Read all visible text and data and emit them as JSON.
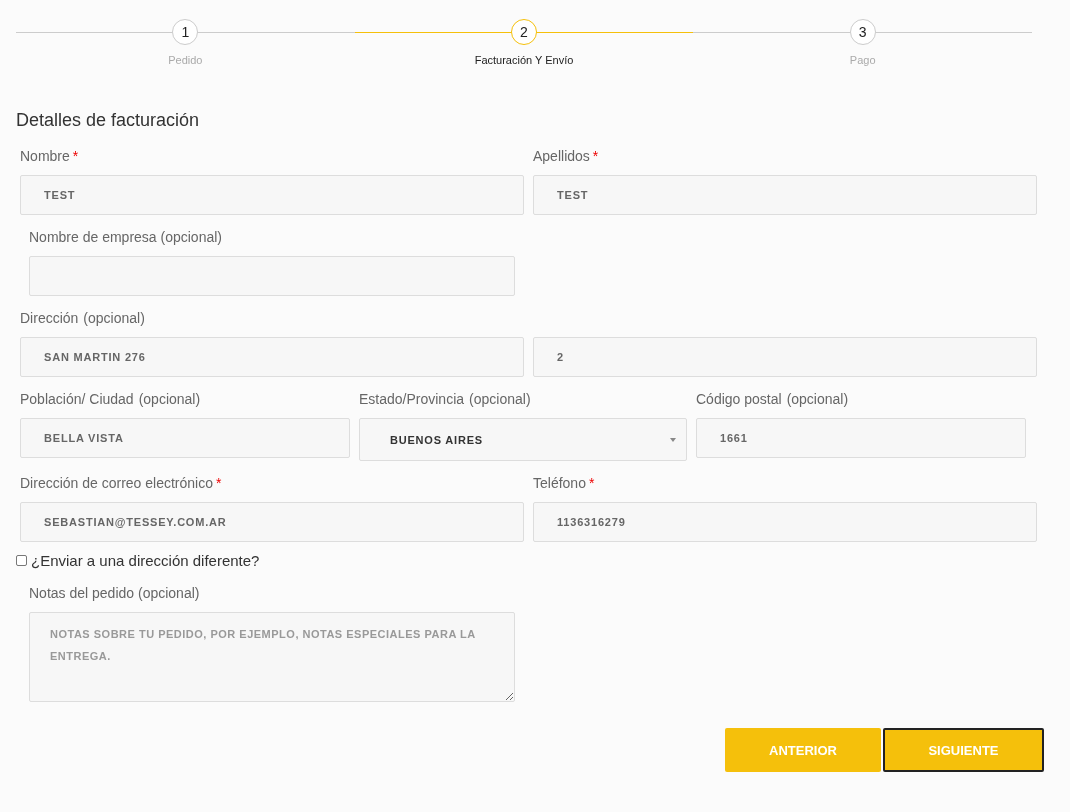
{
  "steps": [
    {
      "number": "1",
      "label": "Pedido",
      "selected": false
    },
    {
      "number": "2",
      "label": "Facturación Y Envío",
      "selected": true
    },
    {
      "number": "3",
      "label": "Pago",
      "selected": false
    }
  ],
  "heading": "Detalles de facturación",
  "rows": [
    {
      "kind": "half",
      "fields": [
        {
          "kind": "text",
          "label": "Nombre",
          "required_mark": "*",
          "value": "TEST"
        },
        {
          "kind": "text",
          "label": "Apellidos",
          "required_mark": "*",
          "value": "TEST"
        }
      ]
    },
    {
      "kind": "indented",
      "fields": [
        {
          "kind": "text",
          "label": "Nombre de empresa (opcional)"
        }
      ]
    },
    {
      "kind": "half",
      "fields": [
        {
          "kind": "text",
          "label": "Dirección",
          "optional_note": "(opcional)",
          "value": "SAN MARTIN 276"
        },
        {
          "kind": "text",
          "value": "2"
        }
      ]
    },
    {
      "kind": "third",
      "fields": [
        {
          "kind": "text",
          "label": "Población/ Ciudad",
          "optional_note": "(opcional)",
          "value": "BELLA VISTA"
        },
        {
          "kind": "select",
          "label": "Estado/Provincia",
          "optional_note": "(opcional)",
          "value": "BUENOS AIRES"
        },
        {
          "kind": "text",
          "label": "Código postal",
          "optional_note": "(opcional)",
          "value": "1661"
        }
      ]
    },
    {
      "kind": "half",
      "fields": [
        {
          "kind": "text",
          "label": "Dirección de correo electrónico",
          "required_mark": "*",
          "value": "SEBASTIAN@TESSEY.COM.AR"
        },
        {
          "kind": "text",
          "label": "Teléfono",
          "required_mark": "*",
          "value": "1136316279"
        }
      ]
    }
  ],
  "ship_different": {
    "label": "¿Enviar a una dirección diferente?",
    "checked": false
  },
  "notes": {
    "label": "Notas del pedido (opcional)",
    "placeholder": "NOTAS SOBRE TU PEDIDO, POR EJEMPLO, NOTAS ESPECIALES PARA LA ENTREGA."
  },
  "buttons": [
    {
      "label": "ANTERIOR",
      "selected": false
    },
    {
      "label": "SIGUIENTE",
      "selected": true
    }
  ]
}
